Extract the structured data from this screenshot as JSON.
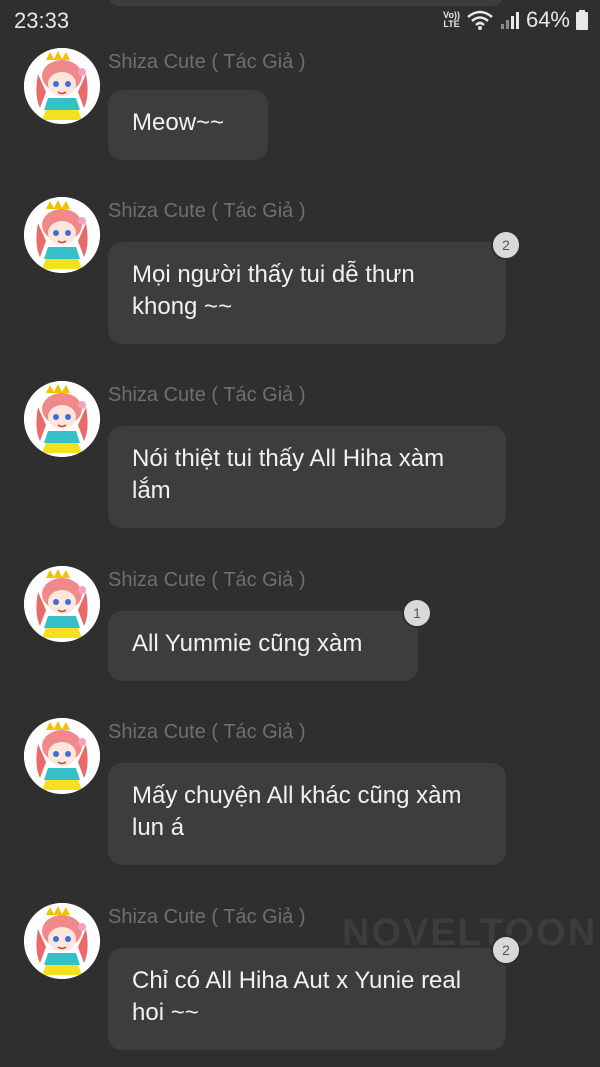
{
  "status_bar": {
    "time": "23:33",
    "network_label": "VoLTE",
    "battery": "64%"
  },
  "watermark": "NOVELTOON",
  "messages": [
    {
      "sender": "Shiza Cute ( Tác Giả )",
      "text": "Meow~~",
      "badge": ""
    },
    {
      "sender": "Shiza Cute ( Tác Giả )",
      "text": "Mọi người thấy tui dễ thưn khong ~~",
      "badge": "2"
    },
    {
      "sender": "Shiza Cute ( Tác Giả )",
      "text": "Nói thiệt tui thấy All Hiha xàm lắm",
      "badge": ""
    },
    {
      "sender": "Shiza Cute ( Tác Giả )",
      "text": "All Yummie cũng xàm",
      "badge": "1"
    },
    {
      "sender": "Shiza Cute ( Tác Giả )",
      "text": "Mấy chuyện All khác cũng xàm lun á",
      "badge": ""
    },
    {
      "sender": "Shiza Cute ( Tác Giả )",
      "text": "Chỉ có All Hiha Aut x Yunie real hoi ~~",
      "badge": "2"
    }
  ]
}
